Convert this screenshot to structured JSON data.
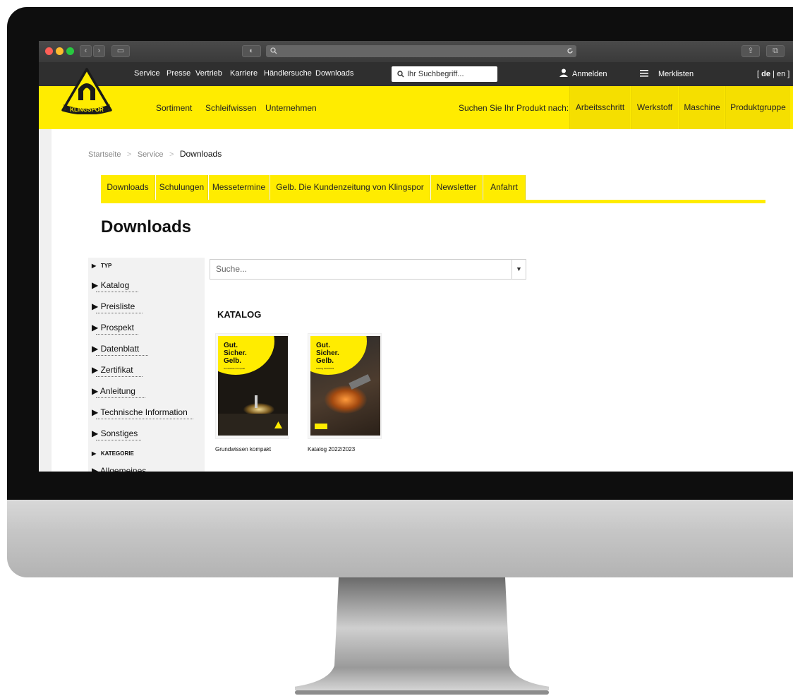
{
  "browser": {
    "address_icon": "search-icon"
  },
  "top_nav": {
    "links": [
      "Service",
      "Presse",
      "Vertrieb",
      "Karriere",
      "Händlersuche",
      "Downloads"
    ],
    "search_placeholder": "Ihr Suchbegriff...",
    "login_label": "Anmelden",
    "wishlist_label": "Merklisten",
    "lang_open": "[",
    "lang_de": "de",
    "lang_sep": "|",
    "lang_en": "en",
    "lang_close": "]"
  },
  "brand": {
    "logo_text": "KLINGSPOR",
    "accent": "#ffec00",
    "dark": "#2f2f2f"
  },
  "main_nav": {
    "links": [
      "Sortiment",
      "Schleifwissen",
      "Unternehmen"
    ],
    "product_search_label": "Suchen Sie Ihr Produkt nach:",
    "filter_tabs": [
      "Arbeitsschritt",
      "Werkstoff",
      "Maschine",
      "Produktgruppe"
    ]
  },
  "breadcrumb": {
    "home": "Startseite",
    "sep1": ">",
    "section": "Service",
    "sep2": ">",
    "current": "Downloads"
  },
  "sub_tabs": [
    "Downloads",
    "Schulungen",
    "Messetermine",
    "Gelb. Die Kundenzeitung von Klingspor",
    "Newsletter",
    "Anfahrt"
  ],
  "page_title": "Downloads",
  "filters": {
    "type_heading": "TYP",
    "type_items": [
      "Katalog",
      "Preisliste",
      "Prospekt",
      "Datenblatt",
      "Zertifikat",
      "Anleitung",
      "Technische Information",
      "Sonstiges"
    ],
    "category_heading": "KATEGORIE",
    "category_items": [
      "Allgemeines"
    ]
  },
  "search": {
    "placeholder": "Suche..."
  },
  "catalog_section": {
    "heading": "KATALOG",
    "items": [
      {
        "title": "Grundwissen kompakt",
        "cover_headline": [
          "Gut.",
          "Sicher.",
          "Gelb."
        ],
        "cover_sub": "Grundwissen Kompakt"
      },
      {
        "title": "Katalog 2022/2023",
        "cover_headline": [
          "Gut.",
          "Sicher.",
          "Gelb."
        ],
        "cover_sub": "Katalog 2022/2023"
      }
    ]
  }
}
